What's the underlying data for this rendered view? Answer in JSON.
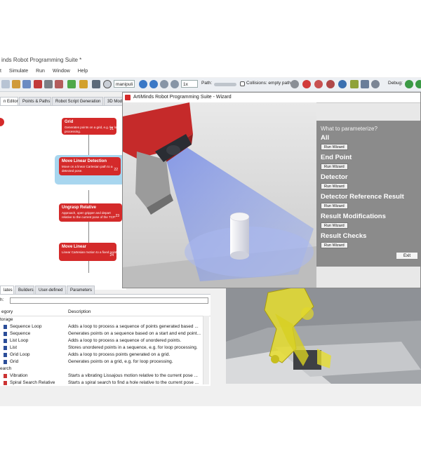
{
  "app": {
    "title": "inds Robot Programming Suite *",
    "menu": [
      "t",
      "Simulate",
      "Run",
      "Window",
      "Help"
    ],
    "toolbar": {
      "template_select": "manipuli",
      "speed_select": "1x",
      "path_label": "Path:",
      "collisions_label": "Collisions: empty path",
      "debug_label": "Debug:"
    },
    "editor_tabs": [
      "n Editor",
      "Points & Paths",
      "Robot Script Generation",
      "3D Mode"
    ]
  },
  "flow": {
    "nodes": [
      {
        "title": "Grid",
        "desc": "Generates points on a grid, e.g. for loop processing.",
        "num": "21"
      },
      {
        "title": "Move Linear Detection",
        "desc": "Move on a linear Cartesian path to a detected pose.",
        "num": "22"
      },
      {
        "title": "Ungrasp Relative",
        "desc": "Approach, open gripper and depart relative to the current pose of the TCP.",
        "num": "23"
      },
      {
        "title": "Move Linear",
        "desc": "Linear Cartesian motion to a fixed point.",
        "num": "24"
      }
    ]
  },
  "library": {
    "tabs": [
      "lates",
      "Builders",
      "User-defined",
      "Parameters"
    ],
    "filter_label": "h:",
    "columns": [
      "egory",
      "Description"
    ],
    "rows": [
      {
        "group": true,
        "name": "torage",
        "desc": ""
      },
      {
        "name": "Sequence Loop",
        "desc": "Adds a loop to process a sequence of points generated based ..."
      },
      {
        "name": "Sequence",
        "desc": "Generates points on a sequence based on a start and end point..."
      },
      {
        "name": "List Loop",
        "desc": "Adds a loop to process a sequence of unordered points."
      },
      {
        "name": "List",
        "desc": "Stores unordered points in a sequence, e.g. for loop processing."
      },
      {
        "name": "Grid Loop",
        "desc": "Adds a loop to process points generated on a grid."
      },
      {
        "name": "Grid",
        "desc": "Generates points on a grid, e.g. for loop processing."
      },
      {
        "group": true,
        "name": "earch",
        "desc": ""
      },
      {
        "name": "Vibration",
        "desc": "Starts a vibrating Lissajous motion relative to the current pose ..."
      },
      {
        "name": "Spiral Search Relative",
        "desc": "Starts a spiral search to find a hole relative to the current pose ..."
      }
    ]
  },
  "wizard": {
    "title": "ArtiMinds Robot Programming Suite - Wizard",
    "heading": "What to parameterize?",
    "sections": [
      {
        "label": "All",
        "button": "Run Wizard"
      },
      {
        "label": "End Point",
        "button": "Run Wizard"
      },
      {
        "label": "Detector",
        "button": "Run Wizard"
      },
      {
        "label": "Detector Reference Result",
        "button": "Run Wizard"
      },
      {
        "label": "Result Modifications",
        "button": "Run Wizard"
      },
      {
        "label": "Result Checks",
        "button": "Run Wizard"
      }
    ],
    "exit_label": "Exit"
  },
  "colors": {
    "node_red": "#d42a2a",
    "selected_node_bg": "#a8d6ef",
    "wizard_panel": "#8b8b8b",
    "cone_blue": "#6f86e6",
    "robot_yellow": "#e6dd2e"
  }
}
